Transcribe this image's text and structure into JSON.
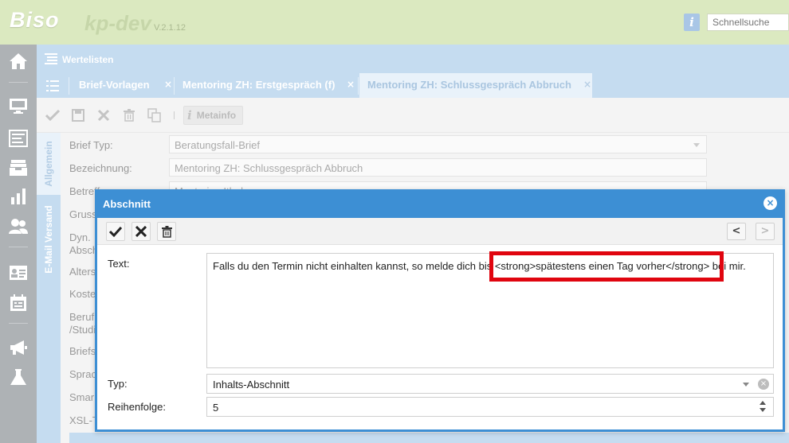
{
  "header": {
    "logo": "Biso",
    "app_name": "kp-dev",
    "version": "V.2.1.12",
    "search_placeholder": "Schnellsuche"
  },
  "nav": {
    "items": [
      "home-icon",
      "monitor-icon",
      "list-icon",
      "inbox-icon",
      "bar-chart-icon",
      "users-icon",
      "contact-card-icon",
      "calendar-icon",
      "megaphone-icon",
      "flask-icon"
    ]
  },
  "page": {
    "title": "Wertelisten",
    "tabs": [
      {
        "label": "Brief-Vorlagen"
      },
      {
        "label": "Mentoring ZH: Erstgespräch (f)"
      },
      {
        "label": "Mentoring ZH: Schlussgespräch Abbruch"
      }
    ],
    "toolbar": {
      "metainfo_label": "Metainfo"
    },
    "vertical_tabs": [
      "Allgemein",
      "E-Mail Versand"
    ],
    "form": {
      "brief_typ_label": "Brief Typ:",
      "brief_typ_value": "Beratungsfall-Brief",
      "bezeichnung_label": "Bezeichnung:",
      "bezeichnung_value": "Mentoring ZH: Schlussgespräch Abbruch",
      "betreff_label": "Betreff",
      "betreff_value": "Mentoring Ithaka",
      "gruss_label": "Gruss",
      "dyn_label": "Dyn.",
      "absch_label": "Absch",
      "alters_label": "Alters",
      "koste_label": "Koste",
      "beruf_label": "Beruf",
      "studi_label": "/Studi",
      "briefs_label": "Briefs",
      "sprac_label": "Sprac",
      "smar_label": "Smar",
      "xsl_label": "XSL-T"
    }
  },
  "dialog": {
    "title": "Abschnitt",
    "nav_prev": "<",
    "nav_next": ">",
    "text_label": "Text:",
    "text_value": "Falls du den Termin nicht einhalten kannst, so melde dich bis <strong>spätestens einen Tag vorher</strong> bei mir.",
    "typ_label": "Typ:",
    "typ_value": "Inhalts-Abschnitt",
    "reihenfolge_label": "Reihenfolge:",
    "reihenfolge_value": "5",
    "highlight_color": "#e0050f",
    "accent_color": "#3d8fd4"
  }
}
